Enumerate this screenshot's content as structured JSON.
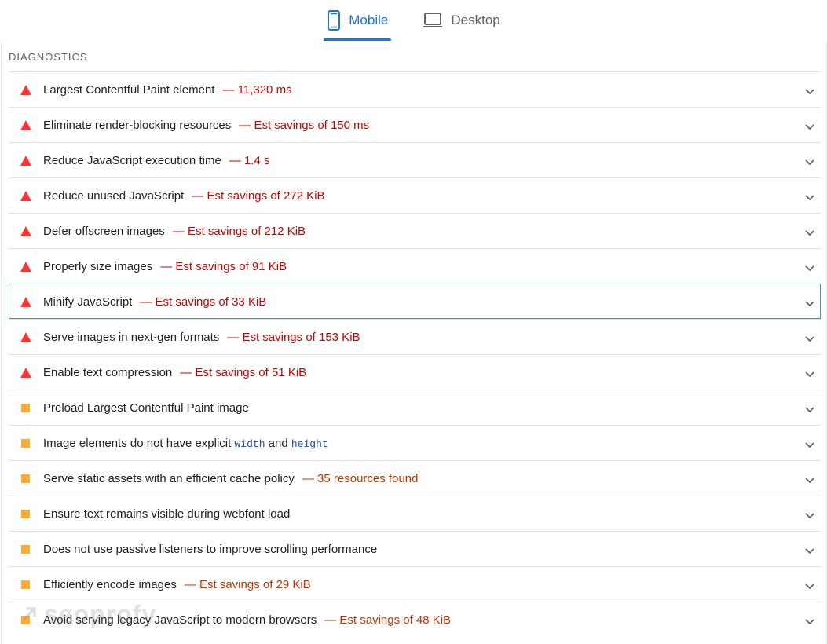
{
  "tabs": [
    {
      "label": "Mobile",
      "icon": "mobile-icon",
      "active": true
    },
    {
      "label": "Desktop",
      "icon": "laptop-icon",
      "active": false
    }
  ],
  "section_title": "DIAGNOSTICS",
  "colors": {
    "accent": "#1a73e8",
    "fail": "#ff3333",
    "average": "#ffaa33",
    "fail_text": "#cc0000",
    "average_text": "#c33300"
  },
  "audits": [
    {
      "status": "fail",
      "title": "Largest Contentful Paint element",
      "display": "— 11,320 ms"
    },
    {
      "status": "fail",
      "title": "Eliminate render-blocking resources",
      "display": "— Est savings of 150 ms"
    },
    {
      "status": "fail",
      "title": "Reduce JavaScript execution time",
      "display": "— 1.4 s"
    },
    {
      "status": "fail",
      "title": "Reduce unused JavaScript",
      "display": "— Est savings of 272 KiB"
    },
    {
      "status": "fail",
      "title": "Defer offscreen images",
      "display": "— Est savings of 212 KiB"
    },
    {
      "status": "fail",
      "title": "Properly size images",
      "display": "— Est savings of 91 KiB"
    },
    {
      "status": "fail",
      "title": "Minify JavaScript",
      "display": "— Est savings of 33 KiB",
      "focused": true
    },
    {
      "status": "fail",
      "title": "Serve images in next-gen formats",
      "display": "— Est savings of 153 KiB"
    },
    {
      "status": "fail",
      "title": "Enable text compression",
      "display": "— Est savings of 51 KiB"
    },
    {
      "status": "average",
      "title": "Preload Largest Contentful Paint image",
      "display": ""
    },
    {
      "status": "average",
      "title_parts": [
        "Image elements do not have explicit ",
        "width",
        " and ",
        "height"
      ],
      "display": ""
    },
    {
      "status": "average",
      "title": "Serve static assets with an efficient cache policy",
      "display": "— 35 resources found"
    },
    {
      "status": "average",
      "title": "Ensure text remains visible during webfont load",
      "display": ""
    },
    {
      "status": "average",
      "title": "Does not use passive listeners to improve scrolling performance",
      "display": ""
    },
    {
      "status": "average",
      "title": "Efficiently encode images",
      "display": "— Est savings of 29 KiB"
    },
    {
      "status": "average",
      "title": "Avoid serving legacy JavaScript to modern browsers",
      "display": "— Est savings of 48 KiB"
    }
  ],
  "watermark": "seoprofy"
}
